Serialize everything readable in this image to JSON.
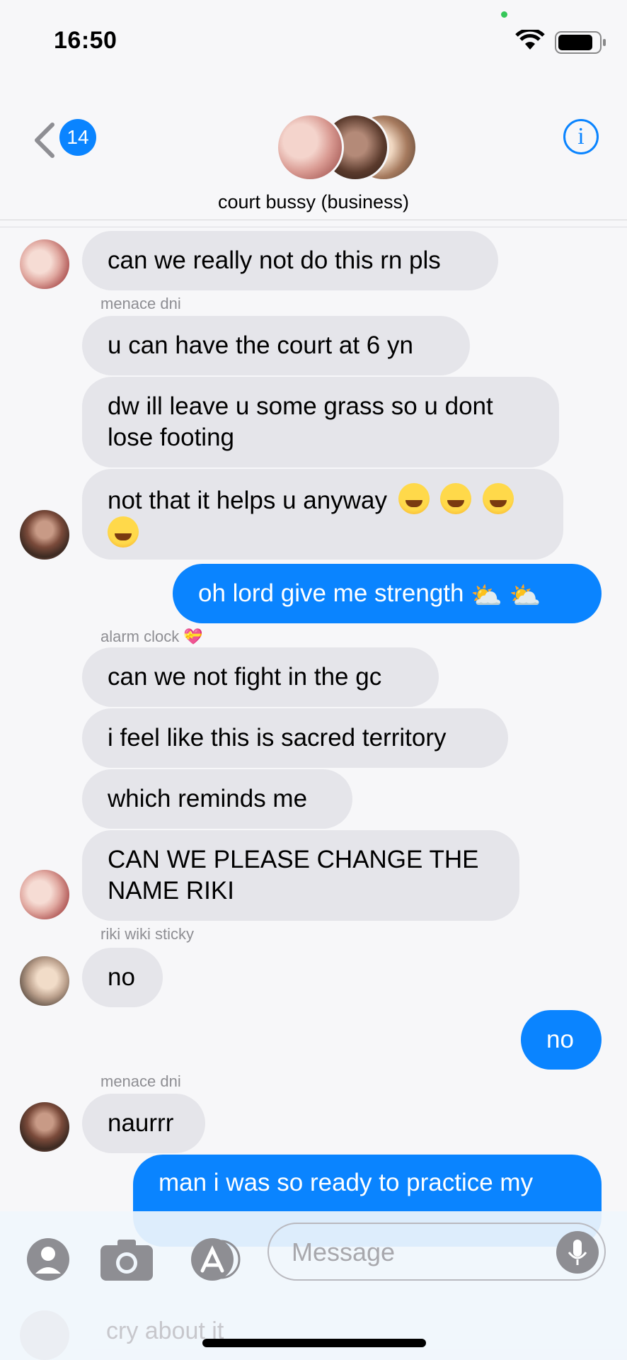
{
  "status": {
    "time": "16:50"
  },
  "header": {
    "back_count": "14",
    "group_name": "court bussy (business)",
    "info_glyph": "i"
  },
  "messages": {
    "m1": "can we really not do this rn pls",
    "sender_menace": "menace dni",
    "m2": "u can have the court at 6 yn",
    "m3": "dw ill leave u some grass so u dont lose footing",
    "m4": "not that it helps u anyway",
    "m5": "oh lord give me strength",
    "sender_alarm": "alarm clock 💝",
    "m6": "can we not fight in the gc",
    "m7": "i feel like this is sacred territory",
    "m8": "which reminds me",
    "m9": "CAN WE PLEASE CHANGE THE NAME RIKI",
    "sender_riki": "riki wiki sticky",
    "m10": "no",
    "m11": "no",
    "sender_menace2": "menace dni",
    "m12": "naurrr",
    "m13": "man i was so ready to practice my",
    "m14_faded": "cry about it"
  },
  "composer": {
    "placeholder": "Message"
  },
  "colors": {
    "accent": "#0a84ff",
    "incoming": "#e5e5ea"
  },
  "icons": [
    "back-chevron-icon",
    "info-icon",
    "contacts-icon",
    "camera-icon",
    "app-store-icon",
    "microphone-icon",
    "wifi-icon",
    "battery-icon"
  ]
}
